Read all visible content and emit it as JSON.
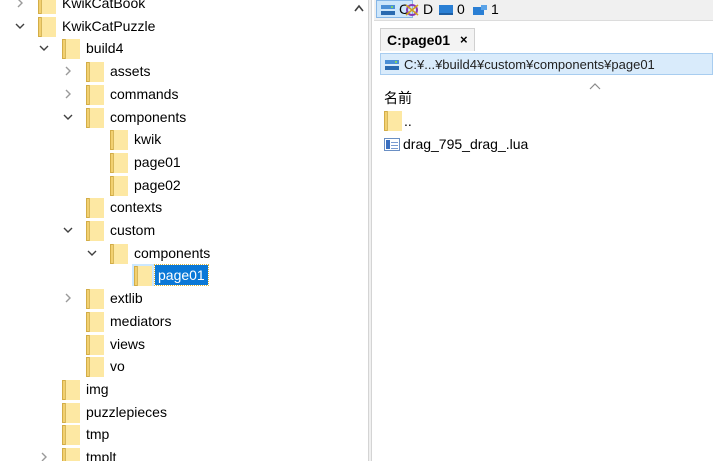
{
  "tree": {
    "rows": [
      {
        "label": "KwikCatBook",
        "chevron": "right"
      },
      {
        "label": "KwikCatPuzzle",
        "chevron": "down"
      },
      {
        "label": "build4",
        "chevron": "down"
      },
      {
        "label": "assets",
        "chevron": "right"
      },
      {
        "label": "commands",
        "chevron": "right"
      },
      {
        "label": "components",
        "chevron": "down"
      },
      {
        "label": "kwik",
        "chevron": ""
      },
      {
        "label": "page01",
        "chevron": ""
      },
      {
        "label": "page02",
        "chevron": ""
      },
      {
        "label": "contexts",
        "chevron": ""
      },
      {
        "label": "custom",
        "chevron": "down"
      },
      {
        "label": "components",
        "chevron": "down"
      },
      {
        "label": "page01",
        "chevron": "",
        "selected": true
      },
      {
        "label": "extlib",
        "chevron": "right"
      },
      {
        "label": "mediators",
        "chevron": ""
      },
      {
        "label": "views",
        "chevron": ""
      },
      {
        "label": "vo",
        "chevron": ""
      },
      {
        "label": "img",
        "chevron": ""
      },
      {
        "label": "puzzlepieces",
        "chevron": ""
      },
      {
        "label": "tmp",
        "chevron": ""
      },
      {
        "label": "tmplt",
        "chevron": "right"
      }
    ]
  },
  "drives": [
    {
      "label": "C",
      "icon": "drive-c-icon",
      "active": true
    },
    {
      "label": "D",
      "icon": "drive-d-icon",
      "active": false
    },
    {
      "label": "0",
      "icon": "drive-0-icon",
      "active": false
    },
    {
      "label": "1",
      "icon": "drive-1-icon",
      "active": false
    }
  ],
  "tab": {
    "label": "C:page01",
    "close": "×"
  },
  "path": "C:¥...¥build4¥custom¥components¥page01",
  "list": {
    "column_name": "名前",
    "items": [
      {
        "name": "..",
        "icon": "folder-icon"
      },
      {
        "name": "drag_795_drag_.lua",
        "icon": "lua-file-icon"
      }
    ]
  },
  "colors": {
    "selection": "#0a78d7",
    "folder": "#f2d070",
    "path_bar": "#d9ebfb"
  }
}
